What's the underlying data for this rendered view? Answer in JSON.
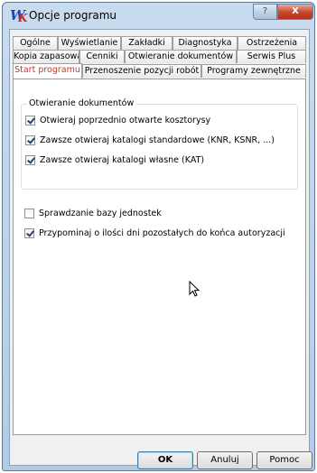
{
  "window": {
    "title": "Opcje programu",
    "help_glyph": "?",
    "close_glyph": "X"
  },
  "tabs": {
    "row1": [
      "Ogólne",
      "Wyświetlanie",
      "Zakładki",
      "Diagnostyka",
      "Ostrzeżenia"
    ],
    "row2": [
      "Kopia zapasowa",
      "Cenniki",
      "Otwieranie dokumentów",
      "Serwis Plus"
    ],
    "row3": [
      "Start programu",
      "Przenoszenie pozycji robót",
      "Programy zewnętrzne"
    ],
    "active": "Start programu"
  },
  "group": {
    "title": "Otwieranie dokumentów",
    "options": [
      {
        "label": "Otwieraj poprzednio otwarte kosztorysy",
        "checked": true
      },
      {
        "label": "Zawsze otwieraj katalogi standardowe (KNR, KSNR, ...)",
        "checked": true
      },
      {
        "label": "Zawsze otwieraj katalogi własne (KAT)",
        "checked": true
      }
    ]
  },
  "options": [
    {
      "label": "Sprawdzanie bazy jednostek",
      "checked": false
    },
    {
      "label": "Przypominaj o ilości dni pozostałych do końca autoryzacji",
      "checked": true
    }
  ],
  "buttons": {
    "ok": "OK",
    "cancel": "Anuluj",
    "help": "Pomoc"
  },
  "colors": {
    "active_tab_text": "#c0392b",
    "close_button": "#c6442a",
    "title_bar": "#c9dcef"
  }
}
